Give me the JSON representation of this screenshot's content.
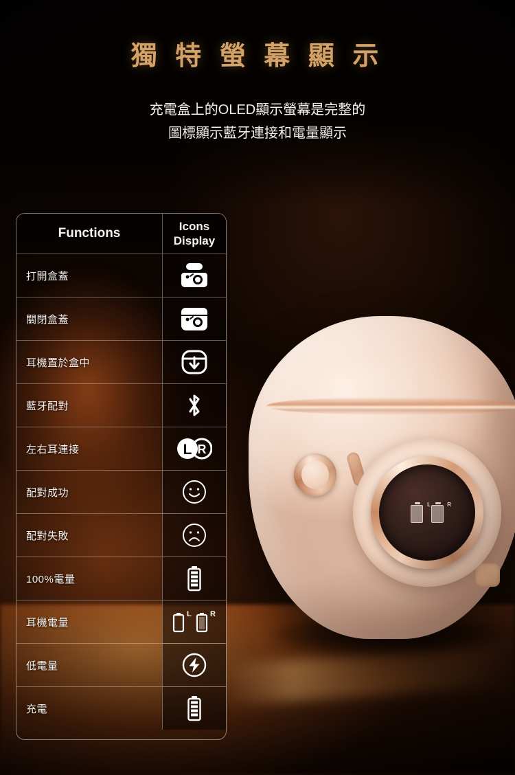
{
  "headline": {
    "title": "獨 特 螢 幕 顯 示",
    "subtitle_line1": "充電盒上的OLED顯示螢幕是完整的",
    "subtitle_line2": "圖標顯示藍牙連接和電量顯示"
  },
  "table": {
    "header": {
      "functions": "Functions",
      "icons_line1": "Icons",
      "icons_line2": "Display"
    },
    "rows": [
      {
        "label": "打開盒蓋",
        "icon": "case-lid-open-icon"
      },
      {
        "label": "關閉盒蓋",
        "icon": "case-lid-closed-icon"
      },
      {
        "label": "耳機置於盒中",
        "icon": "earbuds-in-case-arrow-down-icon"
      },
      {
        "label": "藍牙配對",
        "icon": "bluetooth-icon"
      },
      {
        "label": "左右耳連接",
        "icon": "left-right-earbud-icon"
      },
      {
        "label": "配對成功",
        "icon": "smiley-happy-icon"
      },
      {
        "label": "配對失敗",
        "icon": "smiley-sad-icon"
      },
      {
        "label": "100%電量",
        "icon": "battery-full-icon"
      },
      {
        "label": "耳機電量",
        "icon": "earbud-battery-lr-icon"
      },
      {
        "label": "低電量",
        "icon": "battery-low-bolt-icon"
      },
      {
        "label": "充電",
        "icon": "battery-charging-icon"
      }
    ]
  },
  "product": {
    "screen_left_label": "L",
    "screen_right_label": "R"
  },
  "icon_labels": {
    "lr_left": "L",
    "lr_right": "R",
    "earbud_batt_left": "L",
    "earbud_batt_right": "R"
  },
  "colors": {
    "title_gold": "#d2a269",
    "text_white": "#f4f1ef",
    "border": "rgba(222,216,212,0.55)",
    "background_dark": "#070302",
    "glow_orange": "#c45c20",
    "product_cream": "#f6e1d2",
    "product_rosegold": "#c98a63"
  }
}
